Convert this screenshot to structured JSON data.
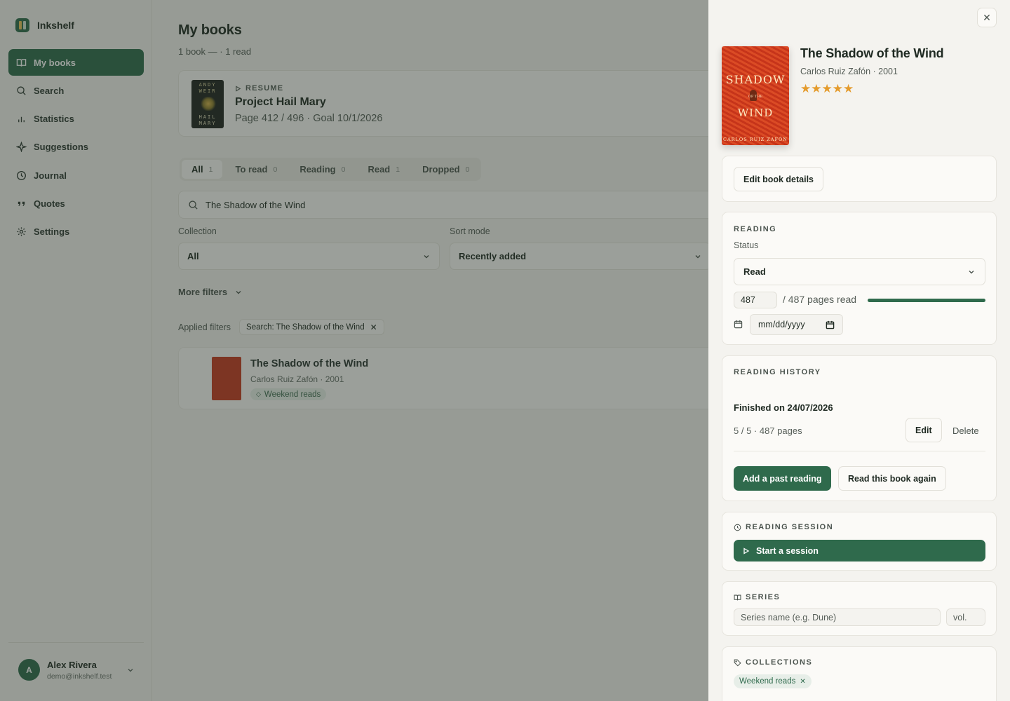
{
  "app": {
    "name": "Inkshelf"
  },
  "nav": [
    {
      "label": "My books",
      "icon": "book-open-icon",
      "active": true
    },
    {
      "label": "Search",
      "icon": "search-icon"
    },
    {
      "label": "Statistics",
      "icon": "bar-chart-icon"
    },
    {
      "label": "Suggestions",
      "icon": "sparkle-icon"
    },
    {
      "label": "Journal",
      "icon": "clock-icon"
    },
    {
      "label": "Quotes",
      "icon": "quote-icon"
    },
    {
      "label": "Settings",
      "icon": "gear-icon"
    }
  ],
  "user": {
    "initial": "A",
    "name": "Alex Rivera",
    "email": "demo@inkshelf.test"
  },
  "main": {
    "title": "My books",
    "subtitle": "1 book — · 1 read",
    "resume": {
      "label": "RESUME",
      "title": "Project Hail Mary",
      "meta": "Page 412 / 496 · Goal 10/1/2026",
      "cover_top": "ANDY WEIR",
      "cover_bottom": "HAIL MARY"
    },
    "tabs": [
      {
        "label": "All",
        "count": "1",
        "active": true
      },
      {
        "label": "To read",
        "count": "0"
      },
      {
        "label": "Reading",
        "count": "0"
      },
      {
        "label": "Read",
        "count": "1"
      },
      {
        "label": "Dropped",
        "count": "0"
      }
    ],
    "search_value": "The Shadow of the Wind",
    "collection": {
      "label": "Collection",
      "value": "All"
    },
    "sort": {
      "label": "Sort mode",
      "value": "Recently added"
    },
    "more_filters": "More filters",
    "applied": {
      "label": "Applied filters",
      "chip": "Search: The Shadow of the Wind"
    },
    "book": {
      "title": "The Shadow of the Wind",
      "meta": "Carlos Ruiz Zafón · 2001",
      "tag": "Weekend reads"
    }
  },
  "panel": {
    "title": "The Shadow of the Wind",
    "meta": "Carlos Ruiz Zafón · 2001",
    "rating": 5,
    "stars": "★★★★★",
    "cover": {
      "t1": "SHADOW",
      "t2": "OF THE",
      "t3": "WIND",
      "author": "CARLOS RUIZ ZAFÓN"
    },
    "edit_details": "Edit book details",
    "reading": {
      "title": "READING",
      "status_label": "Status",
      "status_value": "Read",
      "pages_value": "487",
      "pages_total": "/ 487 pages read",
      "progress": 1.0,
      "date_placeholder": "mm/dd/yyyy"
    },
    "history": {
      "title": "READING HISTORY",
      "finished": "Finished on 24/07/2026",
      "detail": "5 / 5 · 487 pages",
      "edit": "Edit",
      "delete": "Delete",
      "add_past": "Add a past reading",
      "read_again": "Read this book again"
    },
    "session": {
      "title": "READING SESSION",
      "start": "Start a session"
    },
    "series": {
      "title": "SERIES",
      "name_placeholder": "Series name (e.g. Dune)",
      "vol_placeholder": "vol."
    },
    "collections": {
      "title": "COLLECTIONS",
      "tag": "Weekend reads"
    }
  },
  "colors": {
    "accent": "#2f6a4c",
    "star": "#e49b2c",
    "background": "#f4f3ef"
  }
}
